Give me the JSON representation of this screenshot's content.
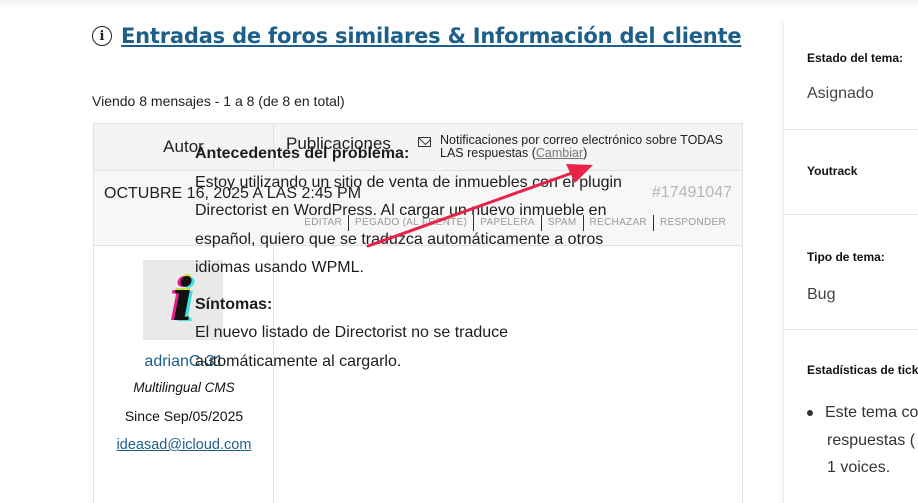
{
  "title": {
    "icon": "info-icon",
    "text": "Entradas de foros similares & Información del cliente"
  },
  "viewing_text": "Viendo 8 mensajes - 1 a 8 (de 8 en total)",
  "table_header": {
    "author": "Autor",
    "posts": "Publicaciones",
    "notify_icon": "mail-icon",
    "notify_text": "Notificaciones por correo electrónico sobre TODAS LAS respuestas",
    "change_open": "(",
    "change_label": "Cambiar",
    "change_close": ")"
  },
  "post": {
    "date": "OCTUBRE 16, 2025 A LAS 2:45 PM",
    "id": "#17491047",
    "admin_links": [
      "EDITAR",
      "PEGADO (AL FRENTE)",
      "PAPELERA",
      "SPAM",
      "RECHAZAR",
      "RESPONDER"
    ],
    "author": {
      "avatar_icon": "avatar-i-icon",
      "avatar_glyph": "i",
      "name": "adrianC-31",
      "role": "Multilingual CMS",
      "since": "Since Sep/05/2025",
      "email": "ideasad@icloud.com"
    },
    "content": {
      "background_heading": "Antecedentes del problema:",
      "background_text": "Estoy utilizando un sitio de venta de inmuebles con el plugin Directorist en WordPress. Al cargar un nuevo inmueble en español, quiero que se traduzca automáticamente a otros idiomas usando WPML.",
      "symptoms_heading": "Síntomas:",
      "symptoms_text": "El nuevo listado de Directorist no se traduce automáticamente al cargarlo."
    }
  },
  "sidebar": {
    "status_label": "Estado del tema:",
    "status_value": "Asignado",
    "youtrack_label": "Youtrack",
    "type_label": "Tipo de tema:",
    "type_value": "Bug",
    "stats_label": "Estadísticas de tick",
    "stats_line1": "Este tema co",
    "stats_line2": "respuestas (",
    "stats_line3": "1 voices."
  },
  "colors": {
    "link": "#1e5f8a",
    "annotation_arrow": "#e8234a"
  }
}
